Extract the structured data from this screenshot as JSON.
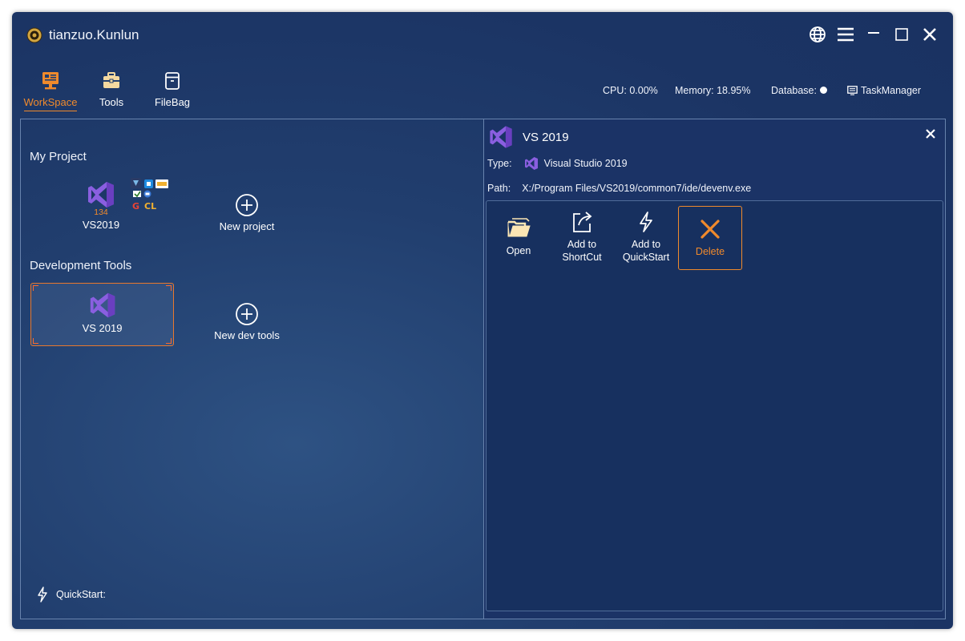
{
  "app": {
    "title": "tianzuo.Kunlun"
  },
  "nav": [
    {
      "label": "WorkSpace",
      "icon": "workspace-icon",
      "active": true
    },
    {
      "label": "Tools",
      "icon": "toolbox-icon",
      "active": false
    },
    {
      "label": "FileBag",
      "icon": "filebag-icon",
      "active": false
    }
  ],
  "status": {
    "cpu": "CPU: 0.00%",
    "memory": "Memory: 18.95%",
    "database": "Database:",
    "task_manager": "TaskManager"
  },
  "workspace": {
    "my_project_title": "My Project",
    "project": {
      "name": "VS2019",
      "badge": "134"
    },
    "new_project": "New project",
    "dev_tools_title": "Development Tools",
    "dev_tool": {
      "name": "VS 2019"
    },
    "new_dev_tools": "New dev tools",
    "quickstart": "QuickStart:"
  },
  "detail": {
    "title": "VS 2019",
    "type_label": "Type:",
    "type_value": "Visual Studio 2019",
    "path_label": "Path:",
    "path_value": "X:/Program Files/VS2019/common7/ide/devenv.exe",
    "actions": [
      {
        "label": "Open",
        "icon": "open-folder-icon"
      },
      {
        "label": "Add to ShortCut",
        "icon": "share-icon"
      },
      {
        "label": "Add to QuickStart",
        "icon": "lightning-icon"
      },
      {
        "label": "Delete",
        "icon": "delete-x-icon"
      }
    ]
  },
  "colors": {
    "accent": "#f08a2c",
    "background": "#1d3767",
    "vs_purple": "#7c4dcc"
  }
}
